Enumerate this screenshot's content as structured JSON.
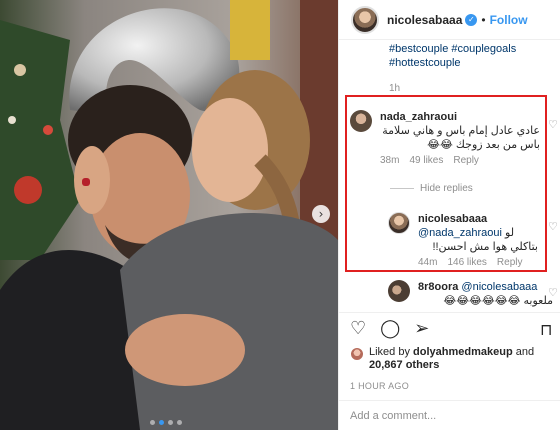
{
  "header": {
    "username": "nicolesabaaa",
    "separator": "•",
    "follow_label": "Follow"
  },
  "caption": {
    "hashtags": [
      "#bestcouple #couplegoals",
      "#hottestcouple"
    ],
    "age": "1h"
  },
  "comments": [
    {
      "username": "nada_zahraoui",
      "text": "عادي عادل إمام باس و هاني سلامة باس من بعد زوجك 😂😂",
      "age": "38m",
      "likes": "49 likes",
      "reply_label": "Reply"
    }
  ],
  "hide_replies_label": "Hide replies",
  "reply": {
    "username": "nicolesabaaa",
    "mention": "@nada_zahraoui",
    "prefix": "لو",
    "text": "بتاكلي هوا مش احسن!!",
    "age": "44m",
    "likes": "146 likes",
    "reply_label": "Reply"
  },
  "comment3": {
    "username": "8r8oora",
    "mention": "@nicolesabaaa",
    "text": "ملعوبه 😂😂😂😂😂😂"
  },
  "likes": {
    "prefix": "Liked by",
    "liker": "dolyahmedmakeup",
    "joiner": "and",
    "count": "20,867 others"
  },
  "post_age": "1 HOUR AGO",
  "add_comment": {
    "placeholder": "Add a comment..."
  },
  "icons": {
    "like": "heart-icon",
    "comment": "comment-icon",
    "share": "share-icon",
    "save": "bookmark-icon",
    "next": "chevron-right-icon"
  },
  "colors": {
    "accent": "#3897f0",
    "link": "#00376b",
    "muted": "#8e8e8e",
    "highlight_box": "#e02020"
  }
}
